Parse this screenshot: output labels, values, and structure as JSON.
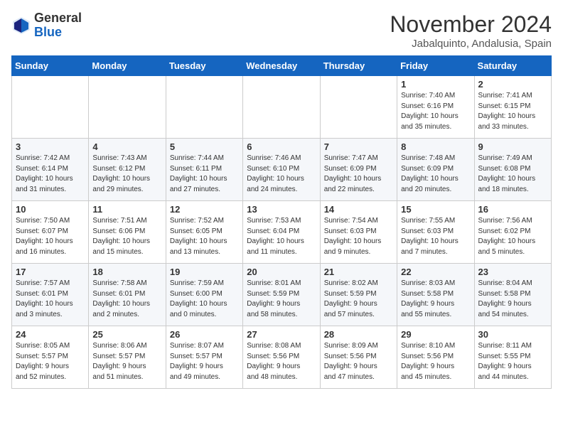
{
  "header": {
    "logo_general": "General",
    "logo_blue": "Blue",
    "month_year": "November 2024",
    "location": "Jabalquinto, Andalusia, Spain"
  },
  "days_of_week": [
    "Sunday",
    "Monday",
    "Tuesday",
    "Wednesday",
    "Thursday",
    "Friday",
    "Saturday"
  ],
  "weeks": [
    {
      "days": [
        {
          "number": "",
          "info": ""
        },
        {
          "number": "",
          "info": ""
        },
        {
          "number": "",
          "info": ""
        },
        {
          "number": "",
          "info": ""
        },
        {
          "number": "",
          "info": ""
        },
        {
          "number": "1",
          "info": "Sunrise: 7:40 AM\nSunset: 6:16 PM\nDaylight: 10 hours\nand 35 minutes."
        },
        {
          "number": "2",
          "info": "Sunrise: 7:41 AM\nSunset: 6:15 PM\nDaylight: 10 hours\nand 33 minutes."
        }
      ]
    },
    {
      "days": [
        {
          "number": "3",
          "info": "Sunrise: 7:42 AM\nSunset: 6:14 PM\nDaylight: 10 hours\nand 31 minutes."
        },
        {
          "number": "4",
          "info": "Sunrise: 7:43 AM\nSunset: 6:12 PM\nDaylight: 10 hours\nand 29 minutes."
        },
        {
          "number": "5",
          "info": "Sunrise: 7:44 AM\nSunset: 6:11 PM\nDaylight: 10 hours\nand 27 minutes."
        },
        {
          "number": "6",
          "info": "Sunrise: 7:46 AM\nSunset: 6:10 PM\nDaylight: 10 hours\nand 24 minutes."
        },
        {
          "number": "7",
          "info": "Sunrise: 7:47 AM\nSunset: 6:09 PM\nDaylight: 10 hours\nand 22 minutes."
        },
        {
          "number": "8",
          "info": "Sunrise: 7:48 AM\nSunset: 6:09 PM\nDaylight: 10 hours\nand 20 minutes."
        },
        {
          "number": "9",
          "info": "Sunrise: 7:49 AM\nSunset: 6:08 PM\nDaylight: 10 hours\nand 18 minutes."
        }
      ]
    },
    {
      "days": [
        {
          "number": "10",
          "info": "Sunrise: 7:50 AM\nSunset: 6:07 PM\nDaylight: 10 hours\nand 16 minutes."
        },
        {
          "number": "11",
          "info": "Sunrise: 7:51 AM\nSunset: 6:06 PM\nDaylight: 10 hours\nand 15 minutes."
        },
        {
          "number": "12",
          "info": "Sunrise: 7:52 AM\nSunset: 6:05 PM\nDaylight: 10 hours\nand 13 minutes."
        },
        {
          "number": "13",
          "info": "Sunrise: 7:53 AM\nSunset: 6:04 PM\nDaylight: 10 hours\nand 11 minutes."
        },
        {
          "number": "14",
          "info": "Sunrise: 7:54 AM\nSunset: 6:03 PM\nDaylight: 10 hours\nand 9 minutes."
        },
        {
          "number": "15",
          "info": "Sunrise: 7:55 AM\nSunset: 6:03 PM\nDaylight: 10 hours\nand 7 minutes."
        },
        {
          "number": "16",
          "info": "Sunrise: 7:56 AM\nSunset: 6:02 PM\nDaylight: 10 hours\nand 5 minutes."
        }
      ]
    },
    {
      "days": [
        {
          "number": "17",
          "info": "Sunrise: 7:57 AM\nSunset: 6:01 PM\nDaylight: 10 hours\nand 3 minutes."
        },
        {
          "number": "18",
          "info": "Sunrise: 7:58 AM\nSunset: 6:01 PM\nDaylight: 10 hours\nand 2 minutes."
        },
        {
          "number": "19",
          "info": "Sunrise: 7:59 AM\nSunset: 6:00 PM\nDaylight: 10 hours\nand 0 minutes."
        },
        {
          "number": "20",
          "info": "Sunrise: 8:01 AM\nSunset: 5:59 PM\nDaylight: 9 hours\nand 58 minutes."
        },
        {
          "number": "21",
          "info": "Sunrise: 8:02 AM\nSunset: 5:59 PM\nDaylight: 9 hours\nand 57 minutes."
        },
        {
          "number": "22",
          "info": "Sunrise: 8:03 AM\nSunset: 5:58 PM\nDaylight: 9 hours\nand 55 minutes."
        },
        {
          "number": "23",
          "info": "Sunrise: 8:04 AM\nSunset: 5:58 PM\nDaylight: 9 hours\nand 54 minutes."
        }
      ]
    },
    {
      "days": [
        {
          "number": "24",
          "info": "Sunrise: 8:05 AM\nSunset: 5:57 PM\nDaylight: 9 hours\nand 52 minutes."
        },
        {
          "number": "25",
          "info": "Sunrise: 8:06 AM\nSunset: 5:57 PM\nDaylight: 9 hours\nand 51 minutes."
        },
        {
          "number": "26",
          "info": "Sunrise: 8:07 AM\nSunset: 5:57 PM\nDaylight: 9 hours\nand 49 minutes."
        },
        {
          "number": "27",
          "info": "Sunrise: 8:08 AM\nSunset: 5:56 PM\nDaylight: 9 hours\nand 48 minutes."
        },
        {
          "number": "28",
          "info": "Sunrise: 8:09 AM\nSunset: 5:56 PM\nDaylight: 9 hours\nand 47 minutes."
        },
        {
          "number": "29",
          "info": "Sunrise: 8:10 AM\nSunset: 5:56 PM\nDaylight: 9 hours\nand 45 minutes."
        },
        {
          "number": "30",
          "info": "Sunrise: 8:11 AM\nSunset: 5:55 PM\nDaylight: 9 hours\nand 44 minutes."
        }
      ]
    }
  ]
}
